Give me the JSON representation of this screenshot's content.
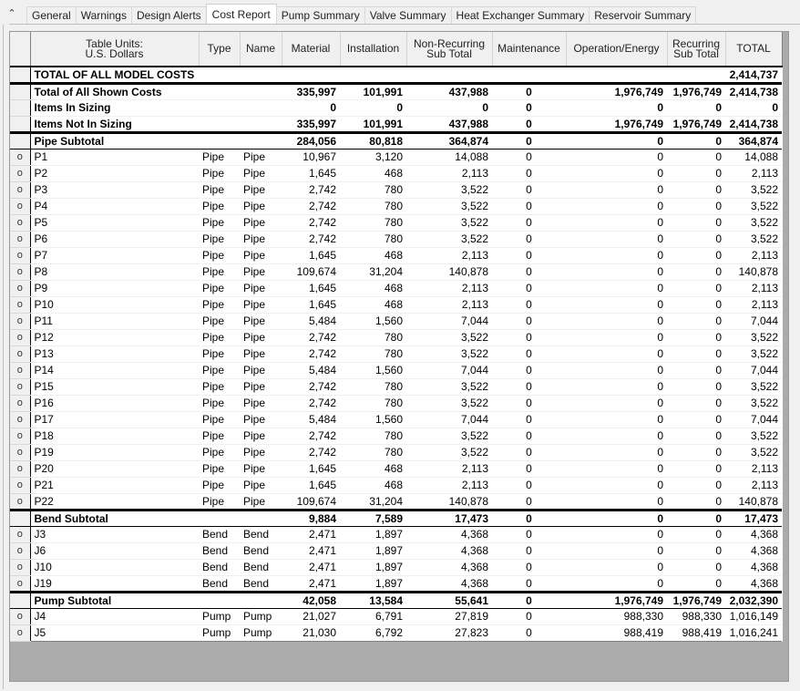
{
  "tabs": [
    {
      "label": "General",
      "active": false
    },
    {
      "label": "Warnings",
      "active": false
    },
    {
      "label": "Design Alerts",
      "active": false
    },
    {
      "label": "Cost Report",
      "active": true
    },
    {
      "label": "Pump Summary",
      "active": false
    },
    {
      "label": "Valve Summary",
      "active": false
    },
    {
      "label": "Heat Exchanger Summary",
      "active": false
    },
    {
      "label": "Reservoir Summary",
      "active": false
    }
  ],
  "collapse_icon": "double-chevron-up-icon",
  "table": {
    "units_label_line1": "Table Units:",
    "units_label_line2": "U.S. Dollars",
    "columns": {
      "type": "Type",
      "name": "Name",
      "material": "Material",
      "installation": "Installation",
      "nonrec_line1": "Non-Recurring",
      "nonrec_line2": "Sub Total",
      "maintenance": "Maintenance",
      "operation": "Operation/Energy",
      "rec_line1": "Recurring",
      "rec_line2": "Sub Total",
      "total": "TOTAL"
    },
    "grand_total": {
      "label": "TOTAL OF ALL MODEL COSTS",
      "total": "2,414,737"
    },
    "summary_rows": [
      {
        "label": "Total of All Shown Costs",
        "material": "335,997",
        "installation": "101,991",
        "nonrec": "437,988",
        "maintenance": "0",
        "operation": "1,976,749",
        "rec": "1,976,749",
        "total": "2,414,738"
      },
      {
        "label": "Items In Sizing",
        "material": "0",
        "installation": "0",
        "nonrec": "0",
        "maintenance": "0",
        "operation": "0",
        "rec": "0",
        "total": "0"
      },
      {
        "label": "Items Not In Sizing",
        "material": "335,997",
        "installation": "101,991",
        "nonrec": "437,988",
        "maintenance": "0",
        "operation": "1,976,749",
        "rec": "1,976,749",
        "total": "2,414,738"
      }
    ],
    "groups": [
      {
        "subtotal": {
          "label": "Pipe Subtotal",
          "material": "284,056",
          "installation": "80,818",
          "nonrec": "364,874",
          "maintenance": "0",
          "operation": "0",
          "rec": "0",
          "total": "364,874"
        },
        "items": [
          {
            "marker": "o",
            "id": "P1",
            "type": "Pipe",
            "name": "Pipe",
            "material": "10,967",
            "installation": "3,120",
            "nonrec": "14,088",
            "maintenance": "0",
            "operation": "0",
            "rec": "0",
            "total": "14,088"
          },
          {
            "marker": "o",
            "id": "P2",
            "type": "Pipe",
            "name": "Pipe",
            "material": "1,645",
            "installation": "468",
            "nonrec": "2,113",
            "maintenance": "0",
            "operation": "0",
            "rec": "0",
            "total": "2,113"
          },
          {
            "marker": "o",
            "id": "P3",
            "type": "Pipe",
            "name": "Pipe",
            "material": "2,742",
            "installation": "780",
            "nonrec": "3,522",
            "maintenance": "0",
            "operation": "0",
            "rec": "0",
            "total": "3,522"
          },
          {
            "marker": "o",
            "id": "P4",
            "type": "Pipe",
            "name": "Pipe",
            "material": "2,742",
            "installation": "780",
            "nonrec": "3,522",
            "maintenance": "0",
            "operation": "0",
            "rec": "0",
            "total": "3,522"
          },
          {
            "marker": "o",
            "id": "P5",
            "type": "Pipe",
            "name": "Pipe",
            "material": "2,742",
            "installation": "780",
            "nonrec": "3,522",
            "maintenance": "0",
            "operation": "0",
            "rec": "0",
            "total": "3,522"
          },
          {
            "marker": "o",
            "id": "P6",
            "type": "Pipe",
            "name": "Pipe",
            "material": "2,742",
            "installation": "780",
            "nonrec": "3,522",
            "maintenance": "0",
            "operation": "0",
            "rec": "0",
            "total": "3,522"
          },
          {
            "marker": "o",
            "id": "P7",
            "type": "Pipe",
            "name": "Pipe",
            "material": "1,645",
            "installation": "468",
            "nonrec": "2,113",
            "maintenance": "0",
            "operation": "0",
            "rec": "0",
            "total": "2,113"
          },
          {
            "marker": "o",
            "id": "P8",
            "type": "Pipe",
            "name": "Pipe",
            "material": "109,674",
            "installation": "31,204",
            "nonrec": "140,878",
            "maintenance": "0",
            "operation": "0",
            "rec": "0",
            "total": "140,878"
          },
          {
            "marker": "o",
            "id": "P9",
            "type": "Pipe",
            "name": "Pipe",
            "material": "1,645",
            "installation": "468",
            "nonrec": "2,113",
            "maintenance": "0",
            "operation": "0",
            "rec": "0",
            "total": "2,113"
          },
          {
            "marker": "o",
            "id": "P10",
            "type": "Pipe",
            "name": "Pipe",
            "material": "1,645",
            "installation": "468",
            "nonrec": "2,113",
            "maintenance": "0",
            "operation": "0",
            "rec": "0",
            "total": "2,113"
          },
          {
            "marker": "o",
            "id": "P11",
            "type": "Pipe",
            "name": "Pipe",
            "material": "5,484",
            "installation": "1,560",
            "nonrec": "7,044",
            "maintenance": "0",
            "operation": "0",
            "rec": "0",
            "total": "7,044"
          },
          {
            "marker": "o",
            "id": "P12",
            "type": "Pipe",
            "name": "Pipe",
            "material": "2,742",
            "installation": "780",
            "nonrec": "3,522",
            "maintenance": "0",
            "operation": "0",
            "rec": "0",
            "total": "3,522"
          },
          {
            "marker": "o",
            "id": "P13",
            "type": "Pipe",
            "name": "Pipe",
            "material": "2,742",
            "installation": "780",
            "nonrec": "3,522",
            "maintenance": "0",
            "operation": "0",
            "rec": "0",
            "total": "3,522"
          },
          {
            "marker": "o",
            "id": "P14",
            "type": "Pipe",
            "name": "Pipe",
            "material": "5,484",
            "installation": "1,560",
            "nonrec": "7,044",
            "maintenance": "0",
            "operation": "0",
            "rec": "0",
            "total": "7,044"
          },
          {
            "marker": "o",
            "id": "P15",
            "type": "Pipe",
            "name": "Pipe",
            "material": "2,742",
            "installation": "780",
            "nonrec": "3,522",
            "maintenance": "0",
            "operation": "0",
            "rec": "0",
            "total": "3,522"
          },
          {
            "marker": "o",
            "id": "P16",
            "type": "Pipe",
            "name": "Pipe",
            "material": "2,742",
            "installation": "780",
            "nonrec": "3,522",
            "maintenance": "0",
            "operation": "0",
            "rec": "0",
            "total": "3,522"
          },
          {
            "marker": "o",
            "id": "P17",
            "type": "Pipe",
            "name": "Pipe",
            "material": "5,484",
            "installation": "1,560",
            "nonrec": "7,044",
            "maintenance": "0",
            "operation": "0",
            "rec": "0",
            "total": "7,044"
          },
          {
            "marker": "o",
            "id": "P18",
            "type": "Pipe",
            "name": "Pipe",
            "material": "2,742",
            "installation": "780",
            "nonrec": "3,522",
            "maintenance": "0",
            "operation": "0",
            "rec": "0",
            "total": "3,522"
          },
          {
            "marker": "o",
            "id": "P19",
            "type": "Pipe",
            "name": "Pipe",
            "material": "2,742",
            "installation": "780",
            "nonrec": "3,522",
            "maintenance": "0",
            "operation": "0",
            "rec": "0",
            "total": "3,522"
          },
          {
            "marker": "o",
            "id": "P20",
            "type": "Pipe",
            "name": "Pipe",
            "material": "1,645",
            "installation": "468",
            "nonrec": "2,113",
            "maintenance": "0",
            "operation": "0",
            "rec": "0",
            "total": "2,113"
          },
          {
            "marker": "o",
            "id": "P21",
            "type": "Pipe",
            "name": "Pipe",
            "material": "1,645",
            "installation": "468",
            "nonrec": "2,113",
            "maintenance": "0",
            "operation": "0",
            "rec": "0",
            "total": "2,113"
          },
          {
            "marker": "o",
            "id": "P22",
            "type": "Pipe",
            "name": "Pipe",
            "material": "109,674",
            "installation": "31,204",
            "nonrec": "140,878",
            "maintenance": "0",
            "operation": "0",
            "rec": "0",
            "total": "140,878"
          }
        ]
      },
      {
        "subtotal": {
          "label": "Bend Subtotal",
          "material": "9,884",
          "installation": "7,589",
          "nonrec": "17,473",
          "maintenance": "0",
          "operation": "0",
          "rec": "0",
          "total": "17,473"
        },
        "items": [
          {
            "marker": "o",
            "id": "J3",
            "type": "Bend",
            "name": "Bend",
            "material": "2,471",
            "installation": "1,897",
            "nonrec": "4,368",
            "maintenance": "0",
            "operation": "0",
            "rec": "0",
            "total": "4,368"
          },
          {
            "marker": "o",
            "id": "J6",
            "type": "Bend",
            "name": "Bend",
            "material": "2,471",
            "installation": "1,897",
            "nonrec": "4,368",
            "maintenance": "0",
            "operation": "0",
            "rec": "0",
            "total": "4,368"
          },
          {
            "marker": "o",
            "id": "J10",
            "type": "Bend",
            "name": "Bend",
            "material": "2,471",
            "installation": "1,897",
            "nonrec": "4,368",
            "maintenance": "0",
            "operation": "0",
            "rec": "0",
            "total": "4,368"
          },
          {
            "marker": "o",
            "id": "J19",
            "type": "Bend",
            "name": "Bend",
            "material": "2,471",
            "installation": "1,897",
            "nonrec": "4,368",
            "maintenance": "0",
            "operation": "0",
            "rec": "0",
            "total": "4,368"
          }
        ]
      },
      {
        "subtotal": {
          "label": "Pump Subtotal",
          "material": "42,058",
          "installation": "13,584",
          "nonrec": "55,641",
          "maintenance": "0",
          "operation": "1,976,749",
          "rec": "1,976,749",
          "total": "2,032,390"
        },
        "items": [
          {
            "marker": "o",
            "id": "J4",
            "type": "Pump",
            "name": "Pump",
            "material": "21,027",
            "installation": "6,791",
            "nonrec": "27,819",
            "maintenance": "0",
            "operation": "988,330",
            "rec": "988,330",
            "total": "1,016,149"
          },
          {
            "marker": "o",
            "id": "J5",
            "type": "Pump",
            "name": "Pump",
            "material": "21,030",
            "installation": "6,792",
            "nonrec": "27,823",
            "maintenance": "0",
            "operation": "988,419",
            "rec": "988,419",
            "total": "1,016,241"
          }
        ]
      }
    ]
  }
}
